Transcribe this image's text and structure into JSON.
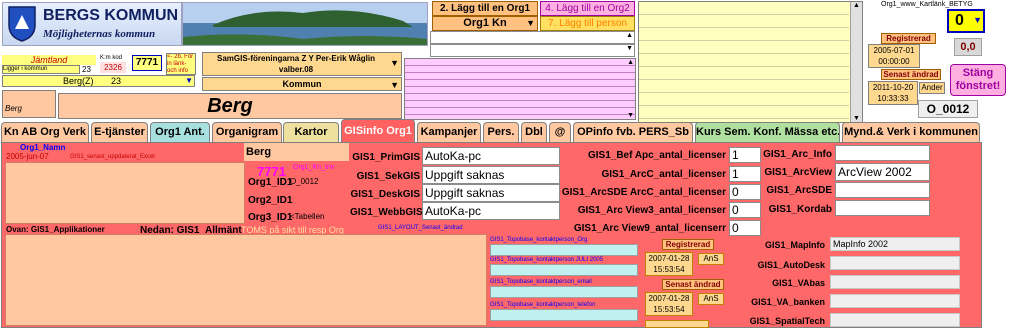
{
  "header": {
    "logo_title": "BERGS KOMMUN",
    "logo_subtitle": "Möjligheternas kommun",
    "btn_add_org1": "2. Lägg till en Org1",
    "btn_add_org2": "4. Lägg till en Org2",
    "org1_kn": "Org1 Kn",
    "btn_add_person": "7. Lägg till person",
    "kartlank_label": "Org1_www_Kartlänk_BETYG",
    "kartlank_value": "0",
    "score_value": "0,0",
    "registrerad_label": "Registrerad",
    "registrerad_date": "2005-07-01",
    "registrerad_time": "00:00:00",
    "senast_andrad_label": "Senast ändrad",
    "senast_andrad_date": "2011-10-20",
    "senast_andrad_time": "10:33:33",
    "andrad_by": "Ander",
    "close_window": "Stäng fönstret!",
    "record_id": "O_0012"
  },
  "region": {
    "lan": "Jämtland",
    "ligger_i": "Ligger i kommun",
    "kommun_num_label": "K:m kod",
    "kommun_num": "23",
    "kommun_kod": "2326",
    "code_7771": "7771",
    "hint": "<- 2b. För in länk- och info",
    "berg_select": "Berg(Z)",
    "berg_num": "23",
    "org_name": "SamGIS-föreningarna Z Y  Per-Erik Wåglin valber.08",
    "kommun_select": "Kommun",
    "berg_small": "Berg",
    "berg_big": "Berg"
  },
  "tabs": [
    {
      "label": "Kn AB Org Verk",
      "color": "#ffc8a0"
    },
    {
      "label": "E-tjänster",
      "color": "#ffc8a0"
    },
    {
      "label": "Org1 Ant.",
      "color": "#a8e0e0"
    },
    {
      "label": "Organigram",
      "color": "#ffc8a0"
    },
    {
      "label": "Kartor",
      "color": "#f0e0a0"
    },
    {
      "label": "GISinfo Org1",
      "color": "#ff6060"
    },
    {
      "label": "Kampanjer",
      "color": "#ffc8a0"
    },
    {
      "label": "Pers.",
      "color": "#ffc8a0"
    },
    {
      "label": "Dbl",
      "color": "#ffc8a0"
    },
    {
      "label": "@",
      "color": "#ffc8a0"
    },
    {
      "label": "OPinfo fvb. PERS_Sb",
      "color": "#ffc8a0"
    },
    {
      "label": "Kurs Sem. Konf. Mässa etc.",
      "color": "#b0e0a0"
    },
    {
      "label": "Mynd.& Verk i kommunen",
      "color": "#ffc8a0"
    }
  ],
  "panel": {
    "org1_namn_label": "Org1_Namn",
    "date_label": "2005-jun-07",
    "senast_excel": "GIS1_senast_uppdaterat_Excel",
    "org1_value": "Berg",
    "code": "7771",
    "kn_inv": "Org1_Kn_Inv",
    "org1_id1_label": "Org1_ID1",
    "org1_id1_value": "O_0012",
    "org2_id1_label": "Org2_ID1",
    "org3_id1_label": "Org3_ID1",
    "org3_id1_value": "<Tabellen",
    "ovan": "Ovan: GIS1_Applikationer",
    "nedan": "Nedan:  GIS1_Allmänt",
    "toms": "TOMS på sikt till resp Org",
    "layout_senast": "GIS1_LAYOUT_Senast_ändrad",
    "primgis_label": "GIS1_PrimGIS",
    "primgis_value": "AutoKa-pc",
    "sekgis_label": "GIS1_SekGIS",
    "sekgis_value": "Uppgift saknas",
    "deskgis_label": "GIS1_DeskGIS",
    "deskgis_value": "Uppgift saknas",
    "webbgis_label": "GIS1_WebbGIS",
    "webbgis_value": "AutoKa-pc",
    "bef_apc_label": "GIS1_Bef Apc_antal_licenser",
    "bef_apc_value": "1",
    "arcc_label": "GIS1_ArcC_antal_licenser",
    "arcc_value": "1",
    "arcsde_lic_label": "GIS1_ArcSDE ArcC_antal_licenser",
    "arcsde_lic_value": "0",
    "arcview3_label": "GIS1_Arc View3_antal_licenser",
    "arcview3_value": "0",
    "arcview9_label": "GIS1_Arc View9_antal_licenserr",
    "arcview9_value": "0",
    "arc_info_label": "GIS1_Arc_Info",
    "arc_view_label": "GIS1_ArcView",
    "arc_view_value": "ArcView 2002",
    "arc_sde_label": "GIS1_ArcSDE",
    "kordab_label": "GIS1_Kordab",
    "mapinfo_label": "GIS1_MapInfo",
    "mapinfo_value": "MapInfo 2002",
    "autodesk_label": "GIS1_AutoDesk",
    "vabas_label": "GIS1_VAbas",
    "va_banken_label": "GIS1_VA_banken",
    "spatialtech_label": "GIS1_SpatialTech",
    "topo_org": "GIS1_Topobase_kontaktperson_Org",
    "topo_juli": "GIS1_Topobase_kontaktperson JULI 2005",
    "topo_email": "GIS1_Topobase_kontaktperson_email",
    "topo_tel": "GIS1_Topobase_kontaktperson_telefon",
    "reg_label": "Registrerad",
    "reg_date": "2007-01-28",
    "reg_time": "15:53:54",
    "reg_by": "AnS",
    "sen_label": "Senast ändrad",
    "sen_date": "2007-01-28",
    "sen_time": "15:53:54",
    "sen_by": "AnS"
  }
}
